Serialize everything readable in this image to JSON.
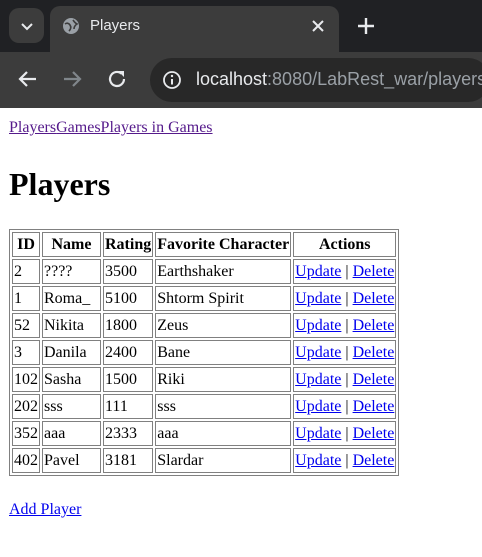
{
  "browser": {
    "tab_title": "Players",
    "url_host": "localhost",
    "url_rest": ":8080/LabRest_war/players"
  },
  "nav": {
    "links": [
      "Players",
      "Games",
      "Players in Games"
    ]
  },
  "page_title": "Players",
  "table": {
    "headers": [
      "ID",
      "Name",
      "Rating",
      "Favorite Character",
      "Actions"
    ],
    "update_label": "Update",
    "separator": "|",
    "delete_label": "Delete",
    "rows": [
      [
        "2",
        "????",
        "3500",
        "Earthshaker"
      ],
      [
        "1",
        "Roma_",
        "5100",
        "Shtorm Spirit"
      ],
      [
        "52",
        "Nikita",
        "1800",
        "Zeus"
      ],
      [
        "3",
        "Danila",
        "2400",
        "Bane"
      ],
      [
        "102",
        "Sasha",
        "1500",
        "Riki"
      ],
      [
        "202",
        "sss",
        "111",
        "sss"
      ],
      [
        "352",
        "aaa",
        "2333",
        "aaa"
      ],
      [
        "402",
        "Pavel",
        "3181",
        "Slardar"
      ]
    ]
  },
  "add_link": "Add Player",
  "colors": {
    "visited_link": "#551a8b",
    "link": "#0000ee",
    "chrome_dark": "#202124",
    "chrome_toolbar": "#3c3c3c"
  }
}
